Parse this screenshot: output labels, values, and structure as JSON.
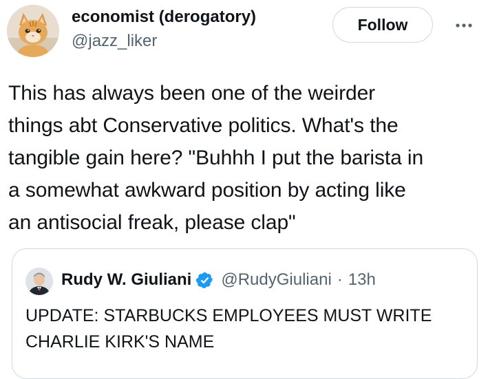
{
  "tweet": {
    "author": {
      "display_name": "economist (derogatory)",
      "handle": "@jazz_liker",
      "avatar_icon": "cat-avatar-icon"
    },
    "follow_label": "Follow",
    "more_icon": "more-horizontal-icon",
    "text_lines": [
      "This has always been one of the weirder",
      "things abt Conservative politics. What's the",
      "tangible gain here? \"Buhhh I put the barista in",
      "a somewhat awkward position by acting like",
      "an antisocial freak, please clap\""
    ]
  },
  "quote": {
    "author": {
      "display_name": "Rudy W. Giuliani",
      "handle": "@RudyGiuliani",
      "separator": "·",
      "time": "13h",
      "verified_icon": "verified-badge-icon",
      "avatar_icon": "person-avatar-icon"
    },
    "text_lines": [
      "UPDATE: STARBUCKS EMPLOYEES MUST WRITE",
      "CHARLIE KIRK'S NAME"
    ]
  },
  "colors": {
    "text_primary": "#0f1419",
    "text_secondary": "#536471",
    "border": "#cfd9de",
    "verified_blue": "#1d9bf0"
  }
}
